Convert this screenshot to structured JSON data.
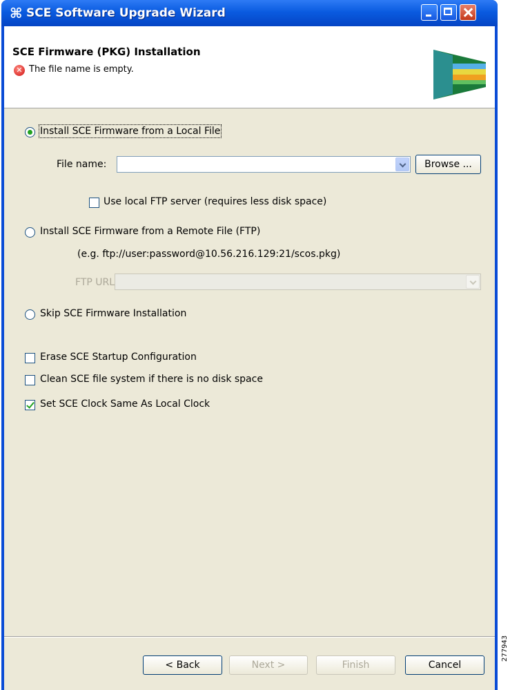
{
  "window": {
    "title": "SCE Software Upgrade Wizard",
    "app_icon": "⌘"
  },
  "header": {
    "page_title": "SCE Firmware (PKG) Installation",
    "error_message": "The file name is empty."
  },
  "options": {
    "local_file": {
      "label": "Install SCE Firmware from a Local File",
      "selected": true
    },
    "file_name_label": "File name:",
    "file_name_value": "",
    "browse_label": "Browse ...",
    "use_local_ftp": {
      "label": "Use local FTP server (requires less disk space)",
      "checked": false
    },
    "remote_file": {
      "label": "Install SCE Firmware from a Remote File (FTP)",
      "selected": false
    },
    "remote_example": "(e.g. ftp://user:password@10.56.216.129:21/scos.pkg)",
    "ftp_url_label": "FTP URL:",
    "ftp_url_value": "",
    "skip": {
      "label": "Skip SCE Firmware Installation",
      "selected": false
    }
  },
  "checkboxes": [
    {
      "label": "Erase SCE Startup Configuration",
      "checked": false
    },
    {
      "label": "Clean SCE file system if there is no disk space",
      "checked": false
    },
    {
      "label": "Set SCE Clock Same As Local Clock",
      "checked": true
    }
  ],
  "footer": {
    "back": "< Back",
    "next": "Next >",
    "finish": "Finish",
    "cancel": "Cancel"
  },
  "figure_id": "277943"
}
